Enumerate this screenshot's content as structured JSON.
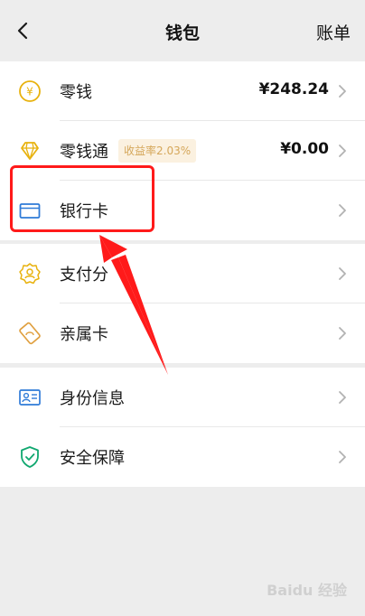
{
  "header": {
    "title": "钱包",
    "bill_label": "账单"
  },
  "groups": [
    {
      "items": [
        {
          "label": "零钱",
          "value": "¥248.24",
          "icon": "yuan-coin-icon"
        },
        {
          "label": "零钱通",
          "badge": "收益率2.03%",
          "value": "¥0.00",
          "icon": "diamond-icon"
        },
        {
          "label": "银行卡",
          "icon": "bank-card-icon"
        }
      ]
    },
    {
      "items": [
        {
          "label": "支付分",
          "icon": "pay-score-icon"
        },
        {
          "label": "亲属卡",
          "icon": "family-card-icon"
        }
      ]
    },
    {
      "items": [
        {
          "label": "身份信息",
          "icon": "id-card-icon"
        },
        {
          "label": "安全保障",
          "icon": "shield-icon"
        }
      ]
    }
  ],
  "annotation": {
    "highlight_target": "银行卡",
    "color": "#ff1a1a"
  },
  "watermark": "Baidu 经验",
  "colors": {
    "accent_yellow": "#e8b20e",
    "accent_blue": "#2f7bd8",
    "accent_green": "#11a870",
    "badge_bg": "#fbf1e0",
    "badge_text": "#d5a75a"
  }
}
